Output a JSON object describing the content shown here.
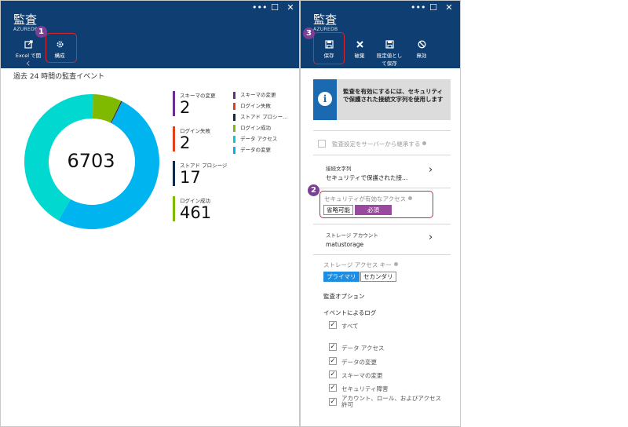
{
  "left_blade": {
    "title": "監査",
    "subtitle": "AZUREDB",
    "window_controls": [
      "•••",
      "☐",
      "✕"
    ],
    "toolbar": [
      {
        "label": "Excel で開く",
        "icon": "excel-open-icon"
      },
      {
        "label": "構成",
        "icon": "gear-icon"
      }
    ],
    "callout_number": "1",
    "chart_title": "過去 24 時間の監査イベント",
    "total": "6703",
    "metrics": [
      {
        "label": "スキーマの変更",
        "value": "2",
        "color": "#6b2c91"
      },
      {
        "label": "ログイン失敗",
        "value": "2",
        "color": "#e0401c"
      },
      {
        "label": "ストアド プロシージ",
        "value": "17",
        "color": "#0f2a4a"
      },
      {
        "label": "ログイン成功",
        "value": "461",
        "color": "#7fba00"
      }
    ],
    "legend": [
      {
        "label": "スキーマの変更",
        "color": "#6b2c91"
      },
      {
        "label": "ログイン失敗",
        "color": "#e0401c"
      },
      {
        "label": "ストアド プロシー...",
        "color": "#0f2a4a"
      },
      {
        "label": "ログイン成功",
        "color": "#7fba00"
      },
      {
        "label": "データ アクセス",
        "color": "#00d0c9"
      },
      {
        "label": "データの変更",
        "color": "#00b4f0"
      }
    ],
    "donut": [
      {
        "name": "データの変更",
        "value": 3400,
        "color": "#00b4f0"
      },
      {
        "name": "データ アクセス",
        "value": 2821,
        "color": "#00d8d0"
      },
      {
        "name": "ログイン成功",
        "value": 461,
        "color": "#7fba00"
      },
      {
        "name": "ストアド プロシージ",
        "value": 17,
        "color": "#0f2a4a"
      },
      {
        "name": "ログイン失敗",
        "value": 2,
        "color": "#e0401c"
      },
      {
        "name": "スキーマの変更",
        "value": 2,
        "color": "#6b2c91"
      }
    ]
  },
  "right_blade": {
    "title": "監査",
    "subtitle": "AZUREDB",
    "window_controls": [
      "•••",
      "☐",
      "✕"
    ],
    "toolbar": [
      {
        "label": "保存",
        "icon": "save-icon"
      },
      {
        "label": "破棄",
        "icon": "discard-icon"
      },
      {
        "label": "既定値として保存",
        "icon": "save-default-icon"
      },
      {
        "label": "無効",
        "icon": "disable-icon"
      }
    ],
    "callout_save": "3",
    "callout_access": "2",
    "info_text": "監査を有効にするには、セキュリティで保護された接続文字列を使用します",
    "inherit_label": "監査設定をサーバーから継承する",
    "connection": {
      "label": "接続文字列",
      "value": "セキュリティで保護された接..."
    },
    "secure_access": {
      "label": "セキュリティが有効なアクセス",
      "options": [
        "省略可能",
        "必須"
      ],
      "selected": "必須"
    },
    "storage": {
      "label": "ストレージ アカウント",
      "value": "matustorage"
    },
    "storage_key": {
      "label": "ストレージ アクセス キー",
      "options": [
        "プライマリ",
        "セカンダリ"
      ],
      "selected": "プライマリ"
    },
    "audit_options_heading": "監査オプション",
    "log_heading": "イベントによるログ",
    "log_items": [
      {
        "label": "すべて",
        "checked": true
      },
      {
        "label": "データ アクセス",
        "checked": true
      },
      {
        "label": "データの変更",
        "checked": true
      },
      {
        "label": "スキーマの変更",
        "checked": true
      },
      {
        "label": "セキュリティ障害",
        "checked": true
      },
      {
        "label": "アカウント、ロール、およびアクセス許可",
        "checked": true
      }
    ]
  }
}
